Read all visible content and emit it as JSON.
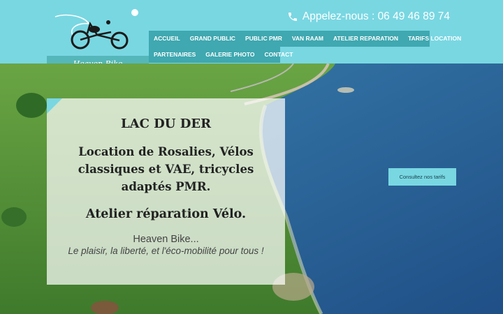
{
  "brand": {
    "logo_text": "Heaven Bike"
  },
  "header": {
    "phone_text": "Appelez-nous : 06 49 46 89 74"
  },
  "nav": {
    "row1": [
      "ACCUEIL",
      "GRAND PUBLIC",
      "PUBLIC PMR",
      "VAN RAAM",
      "ATELIER REPARATION",
      "TARIFS LOCATION"
    ],
    "row2": [
      "PARTENAIRES",
      "GALERIE PHOTO",
      "CONTACT"
    ]
  },
  "hero": {
    "title": "LAC DU DER",
    "subtitle": "Location de Rosalies, Vélos classiques et VAE, tricycles adaptés PMR.",
    "subtitle2": "Atelier réparation Vélo.",
    "brand_line": "Heaven Bike...",
    "slogan": "Le plaisir, la liberté, et l'éco-mobilité pour tous !",
    "cta_label": "Consultez nos tarifs"
  },
  "colors": {
    "header_bg": "#79d7e2",
    "nav_bg": "#3fa8b0",
    "logo_label_bg": "#55b7b9",
    "lake": "#2f6ea0",
    "grass": "#5e9a3a"
  }
}
